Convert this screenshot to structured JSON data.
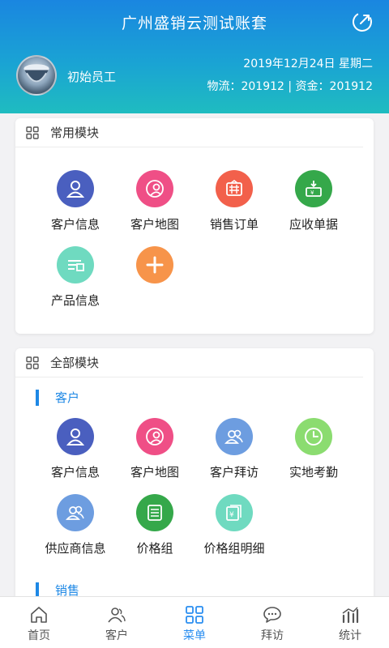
{
  "header": {
    "title": "广州盛销云测试账套",
    "user_name": "初始员工",
    "date": "2019年12月24日  星期二",
    "meta": "物流：201912  |  资金：201912",
    "colors": {
      "top": "#1a86e0",
      "bottom": "#1fbcc0"
    }
  },
  "common": {
    "title": "常用模块",
    "items": [
      {
        "label": "客户信息",
        "icon": "customer-info-icon",
        "color": "#4a5fbf"
      },
      {
        "label": "客户地图",
        "icon": "customer-map-icon",
        "color": "#ef4f86"
      },
      {
        "label": "销售订单",
        "icon": "sales-order-icon",
        "color": "#f2604b"
      },
      {
        "label": "应收单据",
        "icon": "receivable-icon",
        "color": "#35a84a"
      },
      {
        "label": "产品信息",
        "icon": "product-info-icon",
        "color": "#6fdac0"
      },
      {
        "label": "",
        "icon": "add-icon",
        "color": "#f7944a"
      }
    ]
  },
  "all": {
    "title": "全部模块",
    "sections": [
      {
        "title": "客户",
        "items": [
          {
            "label": "客户信息",
            "icon": "customer-info-icon",
            "color": "#4a5fbf"
          },
          {
            "label": "客户地图",
            "icon": "customer-map-icon",
            "color": "#ef4f86"
          },
          {
            "label": "客户拜访",
            "icon": "customer-visit-icon",
            "color": "#6d9de0"
          },
          {
            "label": "实地考勤",
            "icon": "clock-icon",
            "color": "#8bdc70"
          },
          {
            "label": "供应商信息",
            "icon": "supplier-icon",
            "color": "#6d9de0"
          },
          {
            "label": "价格组",
            "icon": "price-group-icon",
            "color": "#35a84a"
          },
          {
            "label": "价格组明细",
            "icon": "price-detail-icon",
            "color": "#6fdac0"
          }
        ]
      },
      {
        "title": "销售",
        "items": []
      }
    ]
  },
  "tabbar": {
    "active": "菜单",
    "active_color": "#2a8ef0",
    "items": [
      {
        "label": "首页",
        "icon": "home-icon"
      },
      {
        "label": "客户",
        "icon": "customer-icon"
      },
      {
        "label": "菜单",
        "icon": "menu-grid-icon"
      },
      {
        "label": "拜访",
        "icon": "chat-icon"
      },
      {
        "label": "统计",
        "icon": "stats-icon"
      }
    ]
  }
}
